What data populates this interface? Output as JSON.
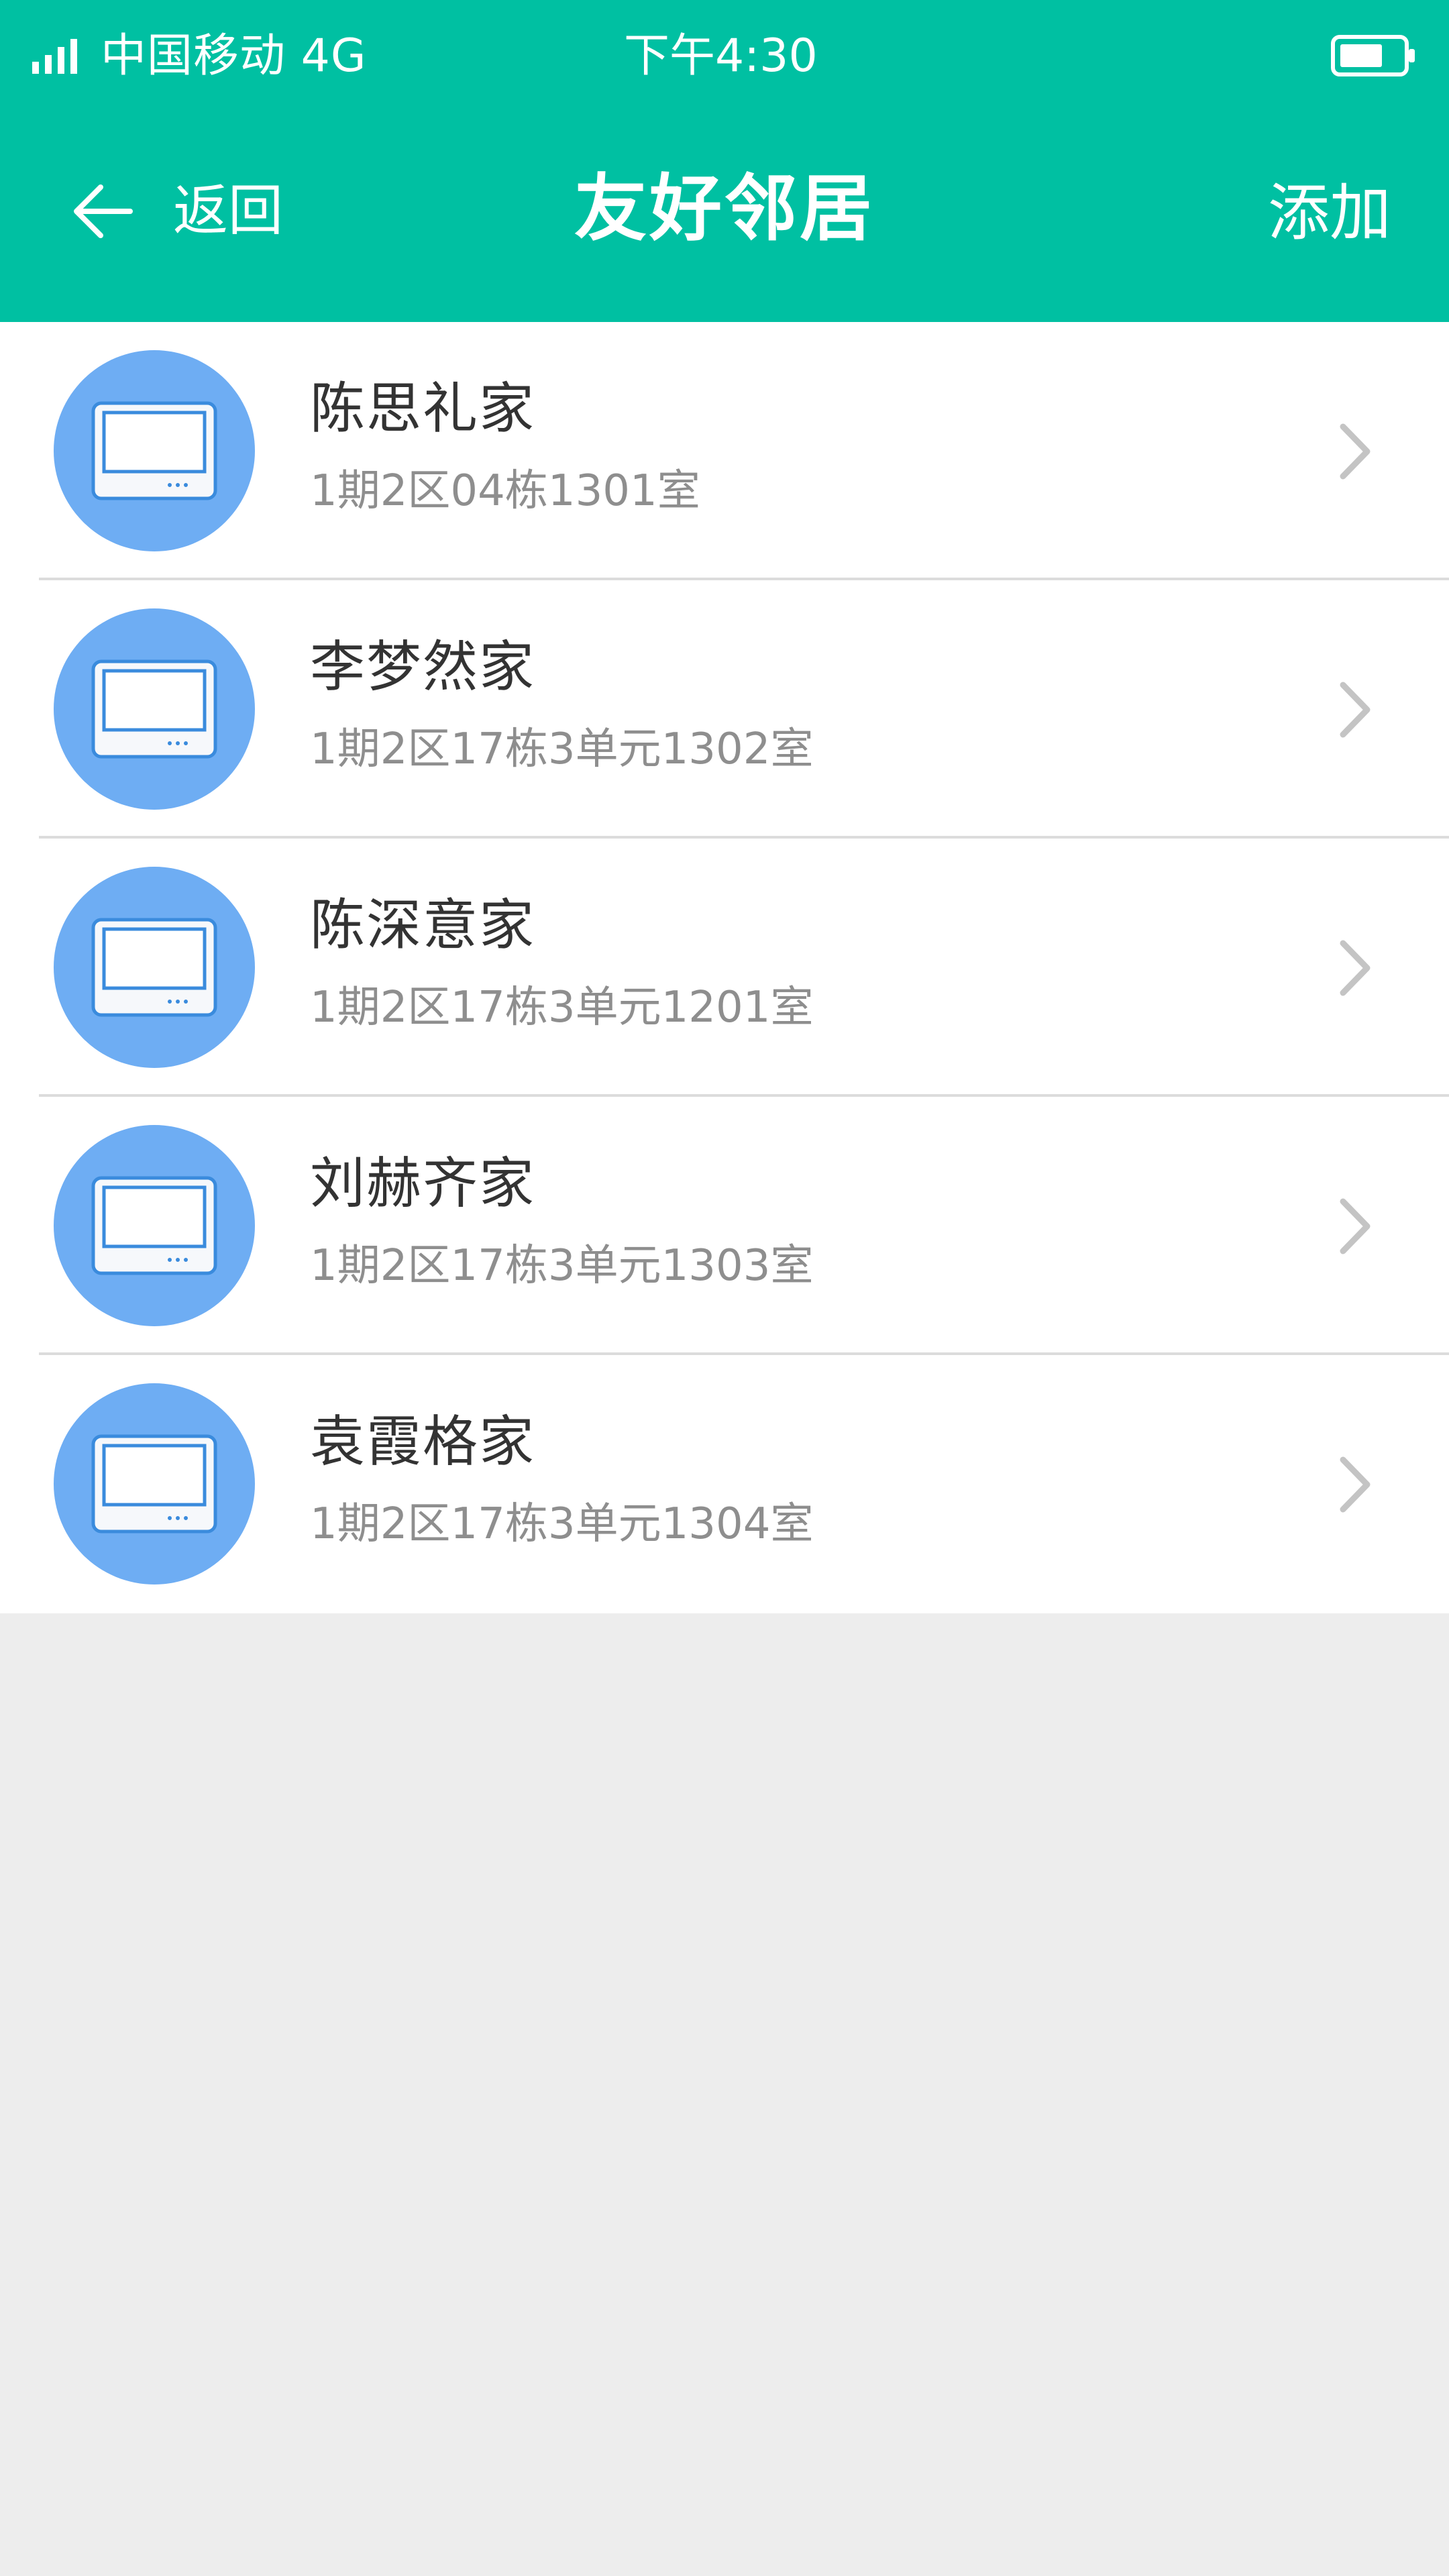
{
  "status_bar": {
    "carrier": "中国移动  4G",
    "time": "下午4:30",
    "signal_icon": "signal-bars-icon",
    "battery_icon": "battery-icon"
  },
  "nav": {
    "back_label": "返回",
    "title": "友好邻居",
    "add_label": "添加",
    "back_icon": "arrow-left-icon"
  },
  "colors": {
    "header": "#00C0A2",
    "avatar": "#6EADF3",
    "page_background": "#EDEDED"
  },
  "neighbors": [
    {
      "name": "陈思礼家",
      "address": "1期2区04栋1301室",
      "icon": "monitor-icon"
    },
    {
      "name": "李梦然家",
      "address": "1期2区17栋3单元1302室",
      "icon": "monitor-icon"
    },
    {
      "name": "陈深意家",
      "address": "1期2区17栋3单元1201室",
      "icon": "monitor-icon"
    },
    {
      "name": "刘赫齐家",
      "address": "1期2区17栋3单元1303室",
      "icon": "monitor-icon"
    },
    {
      "name": "袁霞格家",
      "address": "1期2区17栋3单元1304室",
      "icon": "monitor-icon"
    }
  ]
}
